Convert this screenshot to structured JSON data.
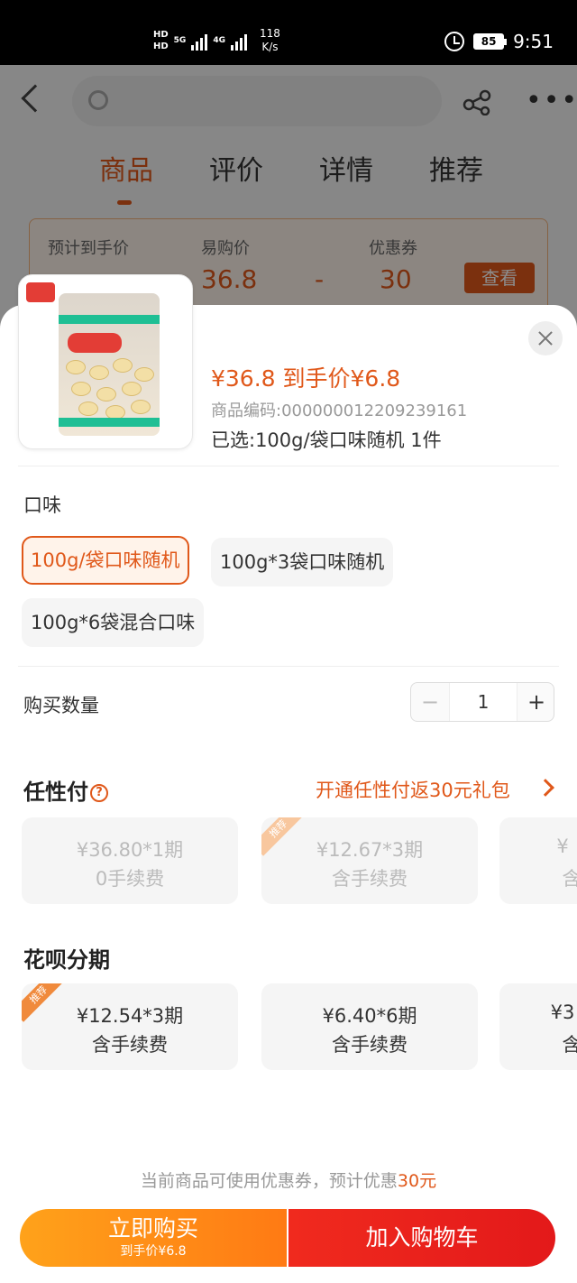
{
  "status_bar": {
    "hd1": "HD",
    "hd2": "HD",
    "net1": "5G",
    "net2": "4G",
    "speed": "118",
    "speed_unit": "K/s",
    "battery": "85",
    "time": "9:51"
  },
  "background": {
    "tabs": [
      "商品",
      "评价",
      "详情",
      "推荐"
    ],
    "promo": {
      "label_expected": "预计到手价",
      "label_yigou": "易购价",
      "value_yigou": "36.8",
      "dash": "-",
      "label_coupon": "优惠券",
      "value_coupon": "30",
      "look_button": "查看"
    }
  },
  "product": {
    "price_line": "¥36.8 到手价¥6.8",
    "code_line": "商品编码:000000012209239161",
    "selected_line": "已选:100g/袋口味随机  1件"
  },
  "flavor": {
    "title": "口味",
    "options": [
      "100g/袋口味随机",
      "100g*3袋口味随机",
      "100g*6袋混合口味"
    ]
  },
  "quantity": {
    "title": "购买数量",
    "minus": "−",
    "value": "1",
    "plus": "+"
  },
  "renxingfu": {
    "title": "任性付",
    "help": "?",
    "link": "开通任性付返30元礼包",
    "badge": "推荐",
    "plans": [
      {
        "l1": "¥36.80*1期",
        "l2": "0手续费"
      },
      {
        "l1": "¥12.67*3期",
        "l2": "含手续费"
      },
      {
        "l1": "¥",
        "l2": "含"
      }
    ]
  },
  "huabei": {
    "title": "花呗分期",
    "badge": "推荐",
    "plans": [
      {
        "l1": "¥12.54*3期",
        "l2": "含手续费"
      },
      {
        "l1": "¥6.40*6期",
        "l2": "含手续费"
      },
      {
        "l1": "¥3",
        "l2": "含"
      }
    ]
  },
  "footer": {
    "coupon_tip_prefix": "当前商品可使用优惠券，预计优惠",
    "coupon_tip_value": "30元",
    "buy_now": "立即购买",
    "buy_now_sub": "到手价¥6.8",
    "add_cart": "加入购物车"
  },
  "colors": {
    "accent": "#e0581a",
    "buy_gradient": "#ff7a14",
    "cart_red": "#e3191a"
  }
}
